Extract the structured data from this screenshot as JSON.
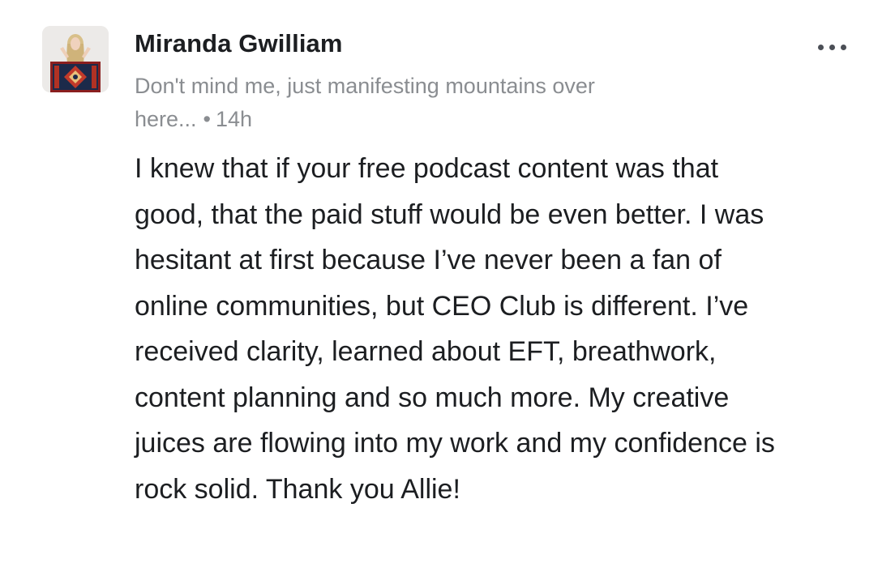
{
  "post": {
    "author": "Miranda Gwilliam",
    "tagline": "Don't mind me, just manifesting mountains over here...",
    "separator": "•",
    "time": "14h",
    "body": "I knew that if your free podcast content was that good, that the paid stuff would be even better. I was hesitant at first because I’ve never been a fan of online communities, but CEO Club is different. I’ve received clarity, learned about EFT, breathwork, content planning and so much more. My creative juices are flowing into my work and my confidence is rock solid. Thank you Allie!"
  },
  "icons": {
    "more": "more-horizontal-icon",
    "avatar": "profile-photo"
  },
  "colors": {
    "author_text": "#1c1e21",
    "meta_text": "#8a8d91",
    "body_text": "#1c1e21",
    "background": "#ffffff"
  }
}
